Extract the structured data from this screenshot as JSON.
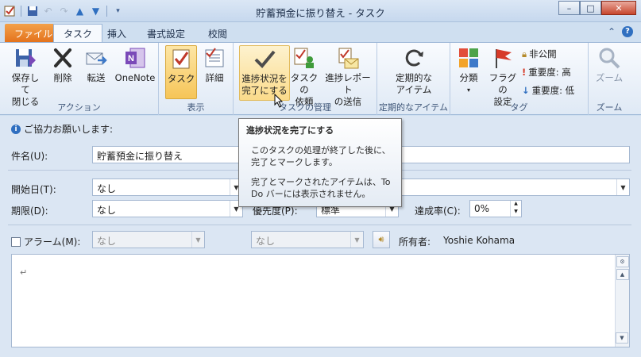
{
  "window": {
    "title": "貯蓄預金に振り替え - タスク",
    "minimize": "–",
    "maximize": "□",
    "close": "✕"
  },
  "qat": {
    "icons": [
      "task-icon",
      "save-icon",
      "undo-icon",
      "redo-icon",
      "up-arrow-icon",
      "down-arrow-icon",
      "customize-icon"
    ]
  },
  "tabs": {
    "file": "ファイル",
    "task": "タスク",
    "insert": "挿入",
    "format": "書式設定",
    "review": "校閲"
  },
  "ribbon": {
    "actions": {
      "label": "アクション",
      "save_close": "保存して\n閉じる",
      "delete": "削除",
      "forward": "転送",
      "onenote": "OneNote"
    },
    "show": {
      "label": "表示",
      "task": "タスク",
      "details": "詳細"
    },
    "manage": {
      "label": "タスクの管理",
      "mark_complete": "進捗状況を\n完了にする",
      "assign": "タスクの\n依頼",
      "send_report": "進捗レポート\nの送信"
    },
    "recurrence": {
      "label": "定期的なアイテム",
      "button": "定期的な\nアイテム"
    },
    "tags": {
      "label": "タグ",
      "categorize": "分類",
      "follow_up": "フラグの\n設定",
      "private": "非公開",
      "high": "重要度: 高",
      "low": "重要度: 低"
    },
    "zoom": {
      "label": "ズーム",
      "button": "ズーム"
    }
  },
  "form": {
    "info": "ご協力お願いします:",
    "subject_label": "件名(U):",
    "subject_value": "貯蓄預金に振り替え",
    "start_label": "開始日(T):",
    "start_value": "なし",
    "due_label": "期限(D):",
    "due_value": "なし",
    "priority_label": "優先度(P):",
    "priority_value": "標準",
    "percent_label": "達成率(C):",
    "percent_value": "0%",
    "reminder_label": "アラーム(M):",
    "reminder_date": "なし",
    "reminder_time": "なし",
    "owner_label": "所有者:",
    "owner_value": "Yoshie Kohama",
    "body_mark": "↵"
  },
  "tooltip": {
    "title": "進捗状況を完了にする",
    "p1": "このタスクの処理が終了した後に、完了とマークします。",
    "p2": "完了とマークされたアイテムは、To Do バーには表示されません。"
  }
}
